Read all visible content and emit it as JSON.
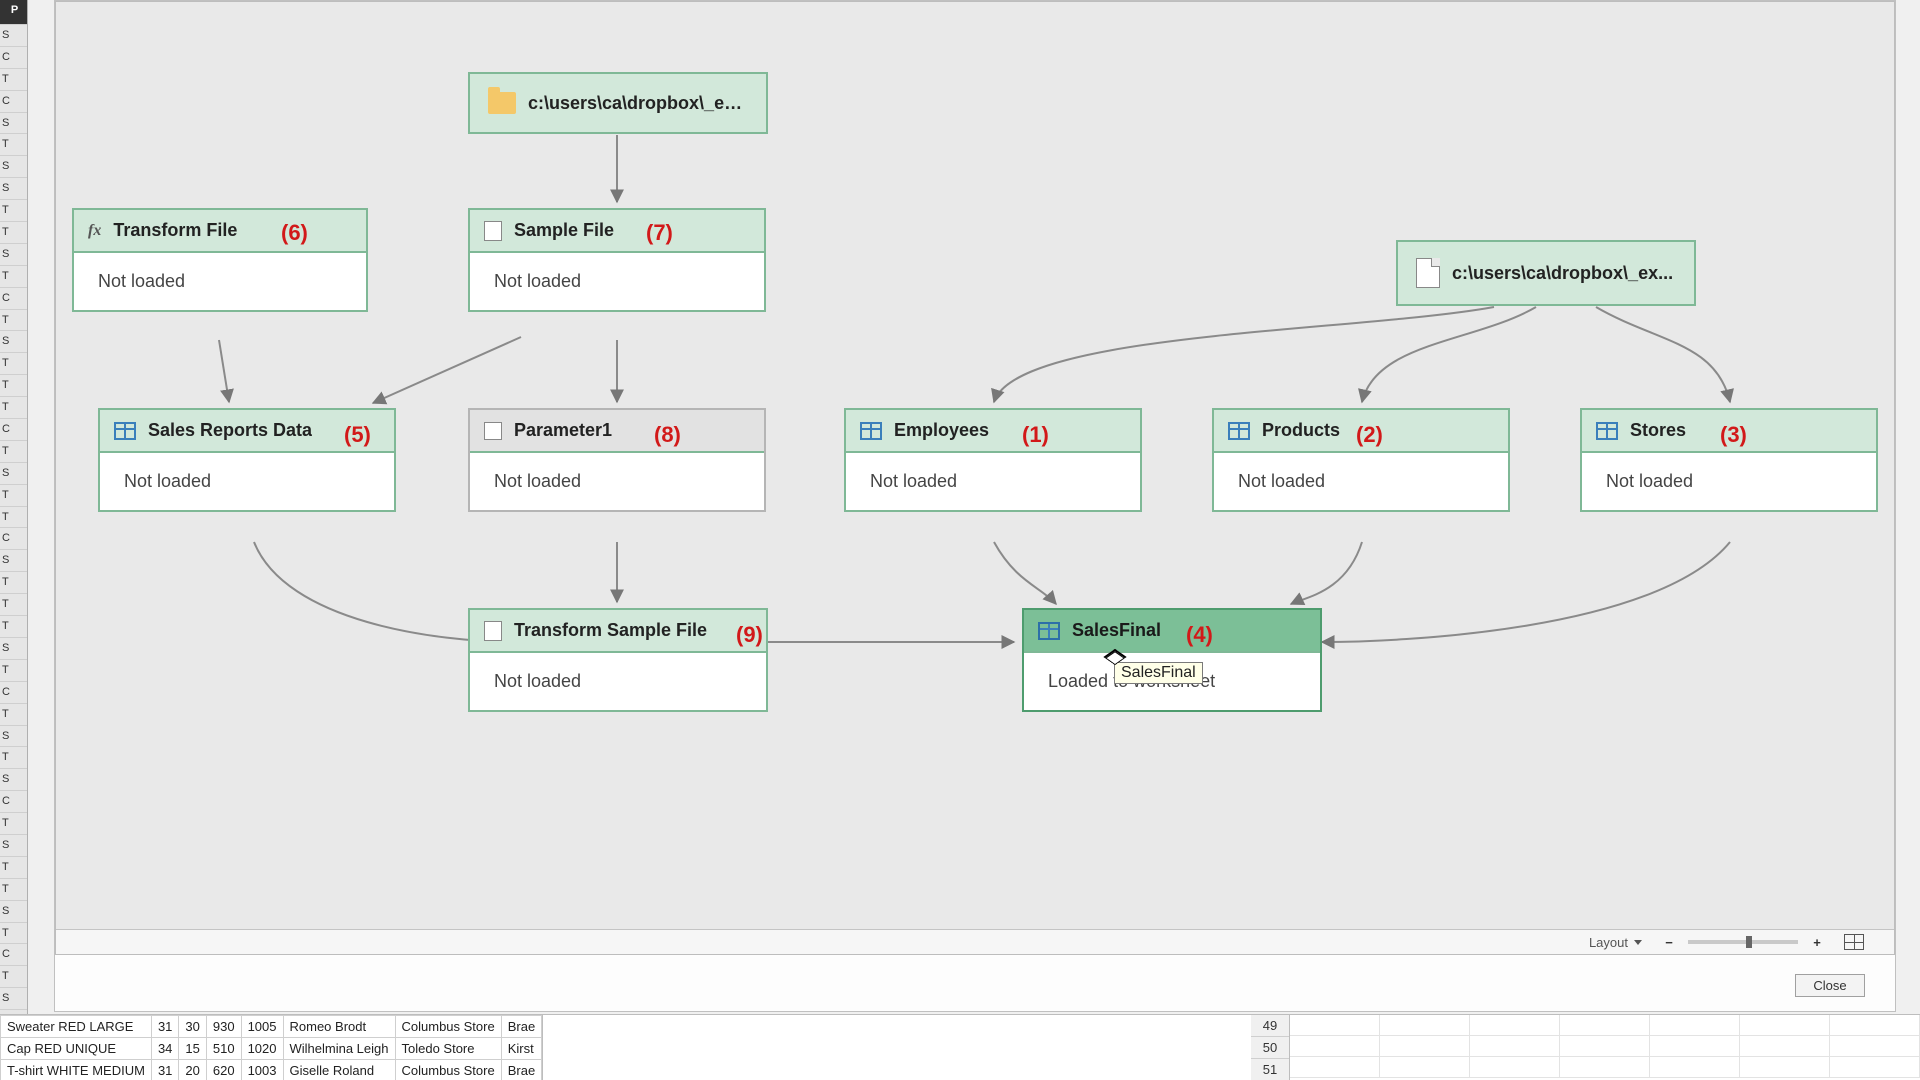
{
  "diagram": {
    "source_folder_label": "c:\\users\\ca\\dropbox\\_ex...",
    "source_file_label": "c:\\users\\ca\\dropbox\\_ex...",
    "nodes": {
      "transform_file": {
        "title": "Transform File",
        "status": "Not loaded"
      },
      "sample_file": {
        "title": "Sample File",
        "status": "Not loaded"
      },
      "sales_reports_data": {
        "title": "Sales Reports Data",
        "status": "Not loaded"
      },
      "parameter1": {
        "title": "Parameter1",
        "status": "Not loaded"
      },
      "employees": {
        "title": "Employees",
        "status": "Not loaded"
      },
      "products": {
        "title": "Products",
        "status": "Not loaded"
      },
      "stores": {
        "title": "Stores",
        "status": "Not loaded"
      },
      "transform_sample_file": {
        "title": "Transform Sample File",
        "status": "Not loaded"
      },
      "sales_final": {
        "title": "SalesFinal",
        "status": "Loaded to worksheet"
      }
    },
    "tooltip": "SalesFinal"
  },
  "annotations": {
    "a1": "(1)",
    "a2": "(2)",
    "a3": "(3)",
    "a4": "(4)",
    "a5": "(5)",
    "a6": "(6)",
    "a7": "(7)",
    "a8": "(8)",
    "a9": "(9)"
  },
  "footer": {
    "layout_label": "Layout",
    "close_label": "Close"
  },
  "sheet": {
    "rows_left": [
      [
        "Sweater RED LARGE",
        "31",
        "30",
        "930",
        "1005",
        "Romeo Brodt",
        "Columbus Store",
        "Brae"
      ],
      [
        "Cap RED UNIQUE",
        "34",
        "15",
        "510",
        "1020",
        "Wilhelmina Leigh",
        "Toledo Store",
        "Kirst"
      ],
      [
        "T-shirt WHITE MEDIUM",
        "31",
        "20",
        "620",
        "1003",
        "Giselle Roland",
        "Columbus Store",
        "Brae"
      ]
    ],
    "row_numbers_right": [
      "49",
      "50",
      "51"
    ]
  }
}
